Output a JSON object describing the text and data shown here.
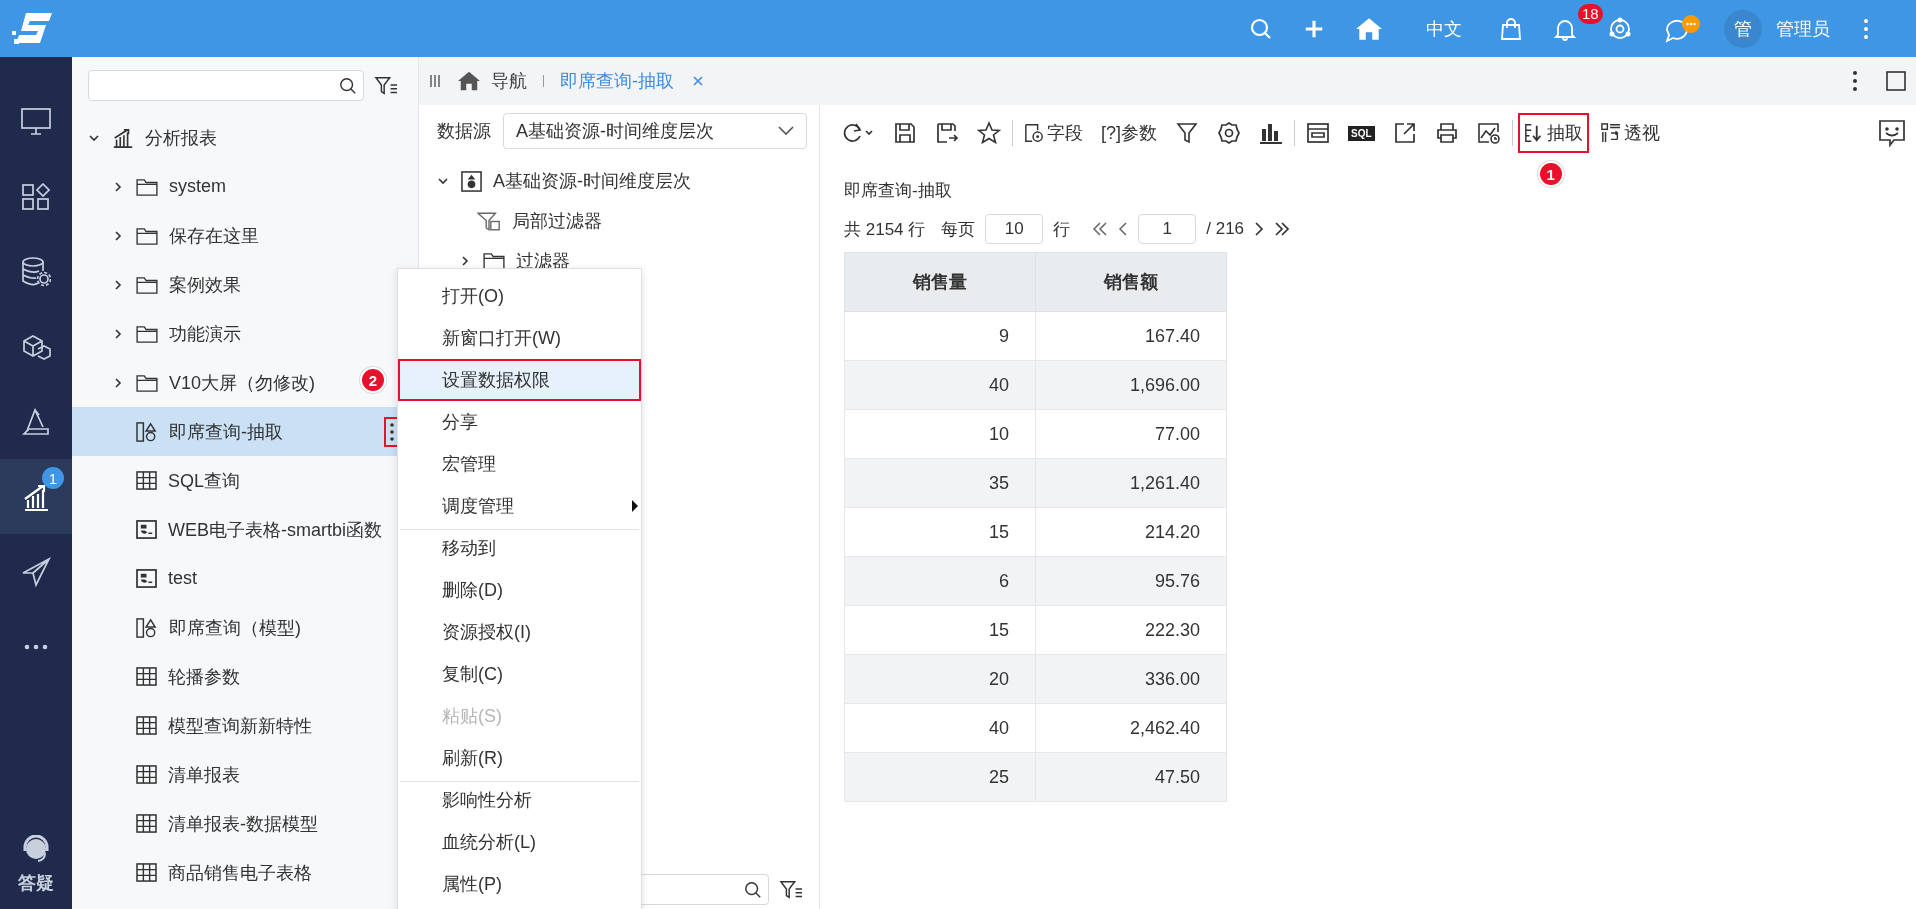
{
  "top_bar": {
    "language": "中文",
    "notification_count": "18",
    "avatar_text": "管",
    "user_name": "管理员"
  },
  "nav_rail": {
    "items": [
      {
        "kind": "monitor",
        "selected": false
      },
      {
        "kind": "apps",
        "selected": false
      },
      {
        "kind": "database",
        "selected": false
      },
      {
        "kind": "cubes",
        "selected": false
      },
      {
        "kind": "ruler",
        "selected": false
      },
      {
        "kind": "analysis",
        "selected": true,
        "callout": "1"
      },
      {
        "kind": "send",
        "selected": false
      },
      {
        "kind": "more",
        "selected": false
      }
    ],
    "help_label": "答疑"
  },
  "resource_tree": {
    "label": "分析报表",
    "expanded": true,
    "children": [
      {
        "label": "system",
        "kind": "folder",
        "expanded": false,
        "selected": false
      },
      {
        "label": "保存在这里",
        "kind": "folder",
        "expanded": false,
        "selected": false
      },
      {
        "label": "案例效果",
        "kind": "folder",
        "expanded": false,
        "selected": false
      },
      {
        "label": "功能演示",
        "kind": "folder",
        "expanded": false,
        "selected": false
      },
      {
        "label": "V10大屏（勿修改)",
        "kind": "folder",
        "expanded": false,
        "selected": false
      },
      {
        "label": "即席查询-抽取",
        "kind": "query",
        "selected": true,
        "outlined": true
      },
      {
        "label": "SQL查询",
        "kind": "table",
        "selected": false
      },
      {
        "label": "WEB电子表格-smartbi函数",
        "kind": "sheet",
        "selected": false
      },
      {
        "label": "test",
        "kind": "sheet",
        "selected": false
      },
      {
        "label": "即席查询（模型)",
        "kind": "query",
        "selected": false
      },
      {
        "label": "轮播参数",
        "kind": "table",
        "selected": false
      },
      {
        "label": "模型查询新新特性",
        "kind": "table",
        "selected": false
      },
      {
        "label": "清单报表",
        "kind": "table",
        "selected": false
      },
      {
        "label": "清单报表-数据模型",
        "kind": "table",
        "selected": false
      },
      {
        "label": "商品销售电子表格",
        "kind": "table",
        "selected": false
      }
    ]
  },
  "tabs": [
    {
      "label": "导航",
      "kind": "home",
      "selected": false
    },
    {
      "label": "即席查询-抽取",
      "kind": "document",
      "selected": true
    }
  ],
  "data_panel": {
    "source_label": "数据源",
    "source_value": "A基础资源-时间维度层次",
    "tree": [
      {
        "label": "A基础资源-时间维度层次",
        "kind": "source",
        "expanded": true,
        "children": [
          {
            "label": "局部过滤器",
            "kind": "filter"
          },
          {
            "label": "过滤器",
            "kind": "folder"
          }
        ]
      }
    ]
  },
  "context_menu": [
    {
      "label": "打开(O)",
      "outlined": false,
      "disabled": false,
      "submenu": false,
      "separator_before": false
    },
    {
      "label": "新窗口打开(W)",
      "outlined": false,
      "disabled": false,
      "submenu": false,
      "separator_before": false
    },
    {
      "label": "设置数据权限",
      "outlined": true,
      "disabled": false,
      "submenu": false,
      "separator_before": false,
      "callout": "2"
    },
    {
      "label": "分享",
      "outlined": false,
      "disabled": false,
      "submenu": false,
      "separator_before": false
    },
    {
      "label": "宏管理",
      "outlined": false,
      "disabled": false,
      "submenu": false,
      "separator_before": false
    },
    {
      "label": "调度管理",
      "outlined": false,
      "disabled": false,
      "submenu": true,
      "separator_before": false
    },
    {
      "label": "移动到",
      "outlined": false,
      "disabled": false,
      "submenu": false,
      "separator_before": true
    },
    {
      "label": "删除(D)",
      "outlined": false,
      "disabled": false,
      "submenu": false,
      "separator_before": false
    },
    {
      "label": "资源授权(I)",
      "outlined": false,
      "disabled": false,
      "submenu": false,
      "separator_before": false
    },
    {
      "label": "复制(C)",
      "outlined": false,
      "disabled": false,
      "submenu": false,
      "separator_before": false
    },
    {
      "label": "粘贴(S)",
      "outlined": false,
      "disabled": true,
      "submenu": false,
      "separator_before": false
    },
    {
      "label": "刷新(R)",
      "outlined": false,
      "disabled": false,
      "submenu": false,
      "separator_before": false
    },
    {
      "label": "影响性分析",
      "outlined": false,
      "disabled": false,
      "submenu": false,
      "separator_before": true
    },
    {
      "label": "血统分析(L)",
      "outlined": false,
      "disabled": false,
      "submenu": false,
      "separator_before": false
    },
    {
      "label": "属性(P)",
      "outlined": false,
      "disabled": false,
      "submenu": false,
      "separator_before": false
    }
  ],
  "toolbar": [
    {
      "kind": "refresh"
    },
    {
      "kind": "save"
    },
    {
      "kind": "save-as"
    },
    {
      "kind": "favorite"
    },
    {
      "kind": "separator"
    },
    {
      "kind": "fields",
      "label": "字段"
    },
    {
      "kind": "text",
      "label": "[?]参数"
    },
    {
      "kind": "filter"
    },
    {
      "kind": "settings"
    },
    {
      "kind": "bar-chart"
    },
    {
      "kind": "separator"
    },
    {
      "kind": "layout"
    },
    {
      "kind": "sql",
      "label": "SQL"
    },
    {
      "kind": "export"
    },
    {
      "kind": "print"
    },
    {
      "kind": "chart-refresh"
    },
    {
      "kind": "separator"
    },
    {
      "kind": "extract",
      "label": "抽取",
      "outlined": true,
      "callout": "1"
    },
    {
      "kind": "pivot",
      "label": "透视"
    }
  ],
  "report": {
    "title": "即席查询-抽取",
    "total_text": "共 2154 行",
    "per_page_label": "每页",
    "per_page": "10",
    "rows_unit": "行",
    "page": "1",
    "page_total": "/ 216",
    "columns": [
      "销售量",
      "销售额"
    ],
    "rows": [
      [
        "9",
        "167.40"
      ],
      [
        "40",
        "1,696.00"
      ],
      [
        "10",
        "77.00"
      ],
      [
        "35",
        "1,261.40"
      ],
      [
        "15",
        "214.20"
      ],
      [
        "6",
        "95.76"
      ],
      [
        "15",
        "222.30"
      ],
      [
        "20",
        "336.00"
      ],
      [
        "40",
        "2,462.40"
      ],
      [
        "25",
        "47.50"
      ]
    ]
  }
}
